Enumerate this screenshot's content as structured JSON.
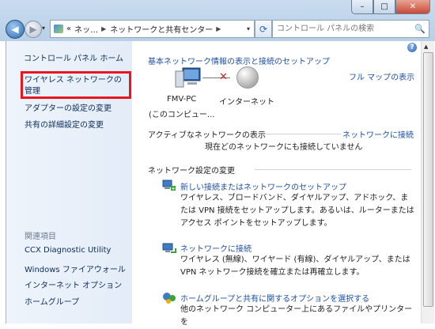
{
  "window": {
    "min_label": "–",
    "max_label": "□",
    "close_label": "✕"
  },
  "address": {
    "overflow": "«",
    "seg1": "ネッ…",
    "seg2": "ネットワークと共有センター",
    "search_placeholder": "コントロール パネルの検索"
  },
  "sidebar": {
    "home": "コントロール パネル ホーム",
    "wireless": "ワイヤレス ネットワークの管理",
    "adapter": "アダプターの設定の変更",
    "sharing": "共有の詳細設定の変更",
    "related_heading": "関連項目",
    "related": [
      "CCX Diagnostic Utility",
      "Windows ファイアウォール",
      "インターネット オプション",
      "ホームグループ"
    ]
  },
  "main": {
    "title": "基本ネットワーク情報の表示と接続のセットアップ",
    "full_map": "フル マップの表示",
    "pc_name": "FMV-PC",
    "pc_sub": "(このコンピュー...",
    "internet": "インターネット",
    "active_heading": "アクティブなネットワークの表示",
    "connect_link": "ネットワークに接続",
    "not_connected": "現在どのネットワークにも接続していません",
    "change_heading": "ネットワーク設定の変更",
    "tasks": [
      {
        "link": "新しい接続またはネットワークのセットアップ",
        "desc": "ワイヤレス、ブロードバンド、ダイヤルアップ、アドホック、または VPN 接続をセットアップします。あるいは、ルーターまたはアクセス ポイントをセットアップします。"
      },
      {
        "link": "ネットワークに接続",
        "desc": "ワイヤレス (無線)、ワイヤード (有線)、ダイヤルアップ、または VPN ネットワーク接続を確立または再確立します。"
      },
      {
        "link": "ホームグループと共有に関するオプションを選択する",
        "desc": "他のネットワーク コンピューター上にあるファイルやプリンターを"
      }
    ]
  },
  "colors": {
    "link": "#1d4fa3",
    "highlight": "#e8161e",
    "sidebar_bg": "#e3ecf7"
  }
}
